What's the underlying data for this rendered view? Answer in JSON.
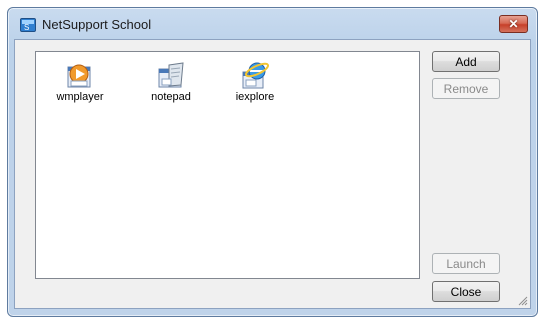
{
  "window": {
    "title": "NetSupport School",
    "close_glyph": "✕"
  },
  "apps": [
    {
      "label": "wmplayer",
      "icon": "wmplayer-icon"
    },
    {
      "label": "notepad",
      "icon": "notepad-icon"
    },
    {
      "label": "iexplore",
      "icon": "iexplore-icon"
    }
  ],
  "buttons": {
    "add": "Add",
    "remove": "Remove",
    "launch": "Launch",
    "close": "Close"
  }
}
